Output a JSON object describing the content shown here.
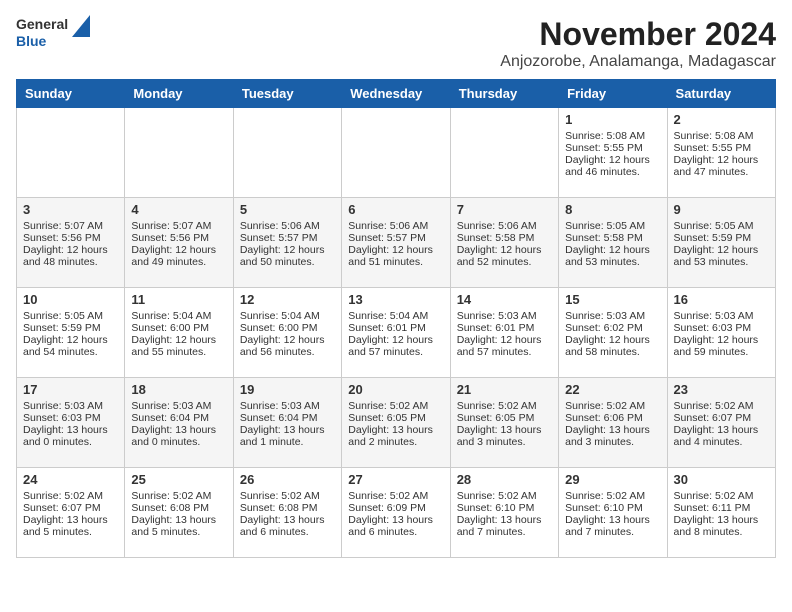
{
  "header": {
    "logo_general": "General",
    "logo_blue": "Blue",
    "month_year": "November 2024",
    "location": "Anjozorobe, Analamanga, Madagascar"
  },
  "days_of_week": [
    "Sunday",
    "Monday",
    "Tuesday",
    "Wednesday",
    "Thursday",
    "Friday",
    "Saturday"
  ],
  "weeks": [
    [
      {
        "day": "",
        "info": ""
      },
      {
        "day": "",
        "info": ""
      },
      {
        "day": "",
        "info": ""
      },
      {
        "day": "",
        "info": ""
      },
      {
        "day": "",
        "info": ""
      },
      {
        "day": "1",
        "info": "Sunrise: 5:08 AM\nSunset: 5:55 PM\nDaylight: 12 hours and 46 minutes."
      },
      {
        "day": "2",
        "info": "Sunrise: 5:08 AM\nSunset: 5:55 PM\nDaylight: 12 hours and 47 minutes."
      }
    ],
    [
      {
        "day": "3",
        "info": "Sunrise: 5:07 AM\nSunset: 5:56 PM\nDaylight: 12 hours and 48 minutes."
      },
      {
        "day": "4",
        "info": "Sunrise: 5:07 AM\nSunset: 5:56 PM\nDaylight: 12 hours and 49 minutes."
      },
      {
        "day": "5",
        "info": "Sunrise: 5:06 AM\nSunset: 5:57 PM\nDaylight: 12 hours and 50 minutes."
      },
      {
        "day": "6",
        "info": "Sunrise: 5:06 AM\nSunset: 5:57 PM\nDaylight: 12 hours and 51 minutes."
      },
      {
        "day": "7",
        "info": "Sunrise: 5:06 AM\nSunset: 5:58 PM\nDaylight: 12 hours and 52 minutes."
      },
      {
        "day": "8",
        "info": "Sunrise: 5:05 AM\nSunset: 5:58 PM\nDaylight: 12 hours and 53 minutes."
      },
      {
        "day": "9",
        "info": "Sunrise: 5:05 AM\nSunset: 5:59 PM\nDaylight: 12 hours and 53 minutes."
      }
    ],
    [
      {
        "day": "10",
        "info": "Sunrise: 5:05 AM\nSunset: 5:59 PM\nDaylight: 12 hours and 54 minutes."
      },
      {
        "day": "11",
        "info": "Sunrise: 5:04 AM\nSunset: 6:00 PM\nDaylight: 12 hours and 55 minutes."
      },
      {
        "day": "12",
        "info": "Sunrise: 5:04 AM\nSunset: 6:00 PM\nDaylight: 12 hours and 56 minutes."
      },
      {
        "day": "13",
        "info": "Sunrise: 5:04 AM\nSunset: 6:01 PM\nDaylight: 12 hours and 57 minutes."
      },
      {
        "day": "14",
        "info": "Sunrise: 5:03 AM\nSunset: 6:01 PM\nDaylight: 12 hours and 57 minutes."
      },
      {
        "day": "15",
        "info": "Sunrise: 5:03 AM\nSunset: 6:02 PM\nDaylight: 12 hours and 58 minutes."
      },
      {
        "day": "16",
        "info": "Sunrise: 5:03 AM\nSunset: 6:03 PM\nDaylight: 12 hours and 59 minutes."
      }
    ],
    [
      {
        "day": "17",
        "info": "Sunrise: 5:03 AM\nSunset: 6:03 PM\nDaylight: 13 hours and 0 minutes."
      },
      {
        "day": "18",
        "info": "Sunrise: 5:03 AM\nSunset: 6:04 PM\nDaylight: 13 hours and 0 minutes."
      },
      {
        "day": "19",
        "info": "Sunrise: 5:03 AM\nSunset: 6:04 PM\nDaylight: 13 hours and 1 minute."
      },
      {
        "day": "20",
        "info": "Sunrise: 5:02 AM\nSunset: 6:05 PM\nDaylight: 13 hours and 2 minutes."
      },
      {
        "day": "21",
        "info": "Sunrise: 5:02 AM\nSunset: 6:05 PM\nDaylight: 13 hours and 3 minutes."
      },
      {
        "day": "22",
        "info": "Sunrise: 5:02 AM\nSunset: 6:06 PM\nDaylight: 13 hours and 3 minutes."
      },
      {
        "day": "23",
        "info": "Sunrise: 5:02 AM\nSunset: 6:07 PM\nDaylight: 13 hours and 4 minutes."
      }
    ],
    [
      {
        "day": "24",
        "info": "Sunrise: 5:02 AM\nSunset: 6:07 PM\nDaylight: 13 hours and 5 minutes."
      },
      {
        "day": "25",
        "info": "Sunrise: 5:02 AM\nSunset: 6:08 PM\nDaylight: 13 hours and 5 minutes."
      },
      {
        "day": "26",
        "info": "Sunrise: 5:02 AM\nSunset: 6:08 PM\nDaylight: 13 hours and 6 minutes."
      },
      {
        "day": "27",
        "info": "Sunrise: 5:02 AM\nSunset: 6:09 PM\nDaylight: 13 hours and 6 minutes."
      },
      {
        "day": "28",
        "info": "Sunrise: 5:02 AM\nSunset: 6:10 PM\nDaylight: 13 hours and 7 minutes."
      },
      {
        "day": "29",
        "info": "Sunrise: 5:02 AM\nSunset: 6:10 PM\nDaylight: 13 hours and 7 minutes."
      },
      {
        "day": "30",
        "info": "Sunrise: 5:02 AM\nSunset: 6:11 PM\nDaylight: 13 hours and 8 minutes."
      }
    ]
  ]
}
